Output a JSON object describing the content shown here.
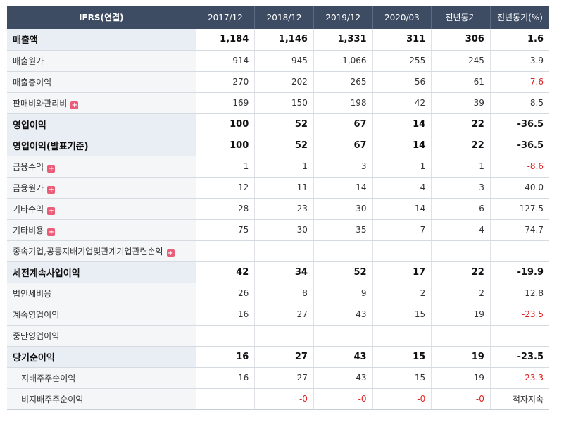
{
  "headers": [
    "IFRS(연결)",
    "2017/12",
    "2018/12",
    "2019/12",
    "2020/03",
    "전년동기",
    "전년동기(%)"
  ],
  "rows": [
    {
      "label": "매출액",
      "bold": true,
      "expand": false,
      "values": [
        "1,184",
        "1,146",
        "1,331",
        "311",
        "306",
        "1.6"
      ]
    },
    {
      "label": "매출원가",
      "bold": false,
      "expand": false,
      "values": [
        "914",
        "945",
        "1,066",
        "255",
        "245",
        "3.9"
      ]
    },
    {
      "label": "매출총이익",
      "bold": false,
      "expand": false,
      "values": [
        "270",
        "202",
        "265",
        "56",
        "61",
        "-7.6"
      ]
    },
    {
      "label": "판매비와관리비",
      "bold": false,
      "expand": true,
      "values": [
        "169",
        "150",
        "198",
        "42",
        "39",
        "8.5"
      ]
    },
    {
      "label": "영업이익",
      "bold": true,
      "expand": false,
      "values": [
        "100",
        "52",
        "67",
        "14",
        "22",
        "-36.5"
      ]
    },
    {
      "label": "영업이익(발표기준)",
      "bold": true,
      "expand": false,
      "values": [
        "100",
        "52",
        "67",
        "14",
        "22",
        "-36.5"
      ]
    },
    {
      "label": "금융수익",
      "bold": false,
      "expand": true,
      "values": [
        "1",
        "1",
        "3",
        "1",
        "1",
        "-8.6"
      ]
    },
    {
      "label": "금융원가",
      "bold": false,
      "expand": true,
      "values": [
        "12",
        "11",
        "14",
        "4",
        "3",
        "40.0"
      ]
    },
    {
      "label": "기타수익",
      "bold": false,
      "expand": true,
      "values": [
        "28",
        "23",
        "30",
        "14",
        "6",
        "127.5"
      ]
    },
    {
      "label": "기타비용",
      "bold": false,
      "expand": true,
      "values": [
        "75",
        "30",
        "35",
        "7",
        "4",
        "74.7"
      ]
    },
    {
      "label": "종속기업,공동지배기업및관계기업관련손익",
      "bold": false,
      "expand": true,
      "values": [
        "",
        "",
        "",
        "",
        "",
        ""
      ]
    },
    {
      "label": "세전계속사업이익",
      "bold": true,
      "expand": false,
      "values": [
        "42",
        "34",
        "52",
        "17",
        "22",
        "-19.9"
      ]
    },
    {
      "label": "법인세비용",
      "bold": false,
      "expand": false,
      "values": [
        "26",
        "8",
        "9",
        "2",
        "2",
        "12.8"
      ]
    },
    {
      "label": "계속영업이익",
      "bold": false,
      "expand": false,
      "values": [
        "16",
        "27",
        "43",
        "15",
        "19",
        "-23.5"
      ]
    },
    {
      "label": "중단영업이익",
      "bold": false,
      "expand": false,
      "values": [
        "",
        "",
        "",
        "",
        "",
        ""
      ]
    },
    {
      "label": "당기순이익",
      "bold": true,
      "expand": false,
      "values": [
        "16",
        "27",
        "43",
        "15",
        "19",
        "-23.5"
      ]
    },
    {
      "label": "지배주주순이익",
      "bold": false,
      "expand": false,
      "indent": true,
      "values": [
        "16",
        "27",
        "43",
        "15",
        "19",
        "-23.3"
      ]
    },
    {
      "label": "비지배주주순이익",
      "bold": false,
      "expand": false,
      "indent": true,
      "values": [
        "",
        "-0",
        "-0",
        "-0",
        "-0",
        "적자지속"
      ]
    }
  ],
  "colors": {
    "header_bg": "#3d4c63",
    "negative": "#e02020",
    "expand_icon": "#e95d78"
  },
  "icons": {
    "expand": "plus-icon"
  }
}
